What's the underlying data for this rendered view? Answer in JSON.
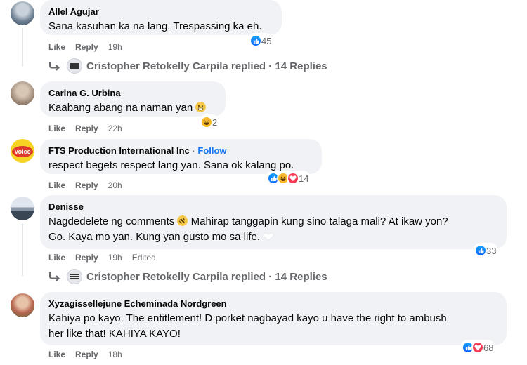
{
  "comments": [
    {
      "author": "Allel Agujar",
      "text": "Sana kasuhan ka na lang. Trespassing ka eh.",
      "actions": {
        "like": "Like",
        "reply": "Reply",
        "time": "19h"
      },
      "reactions": {
        "icons": [
          "like-icon"
        ],
        "count": "45"
      },
      "replies": {
        "name": "Cristopher Retokelly Carpila",
        "label": " replied · 14 Replies"
      }
    },
    {
      "author": "Carina G. Urbina",
      "text": "Kaabang abang na naman yan",
      "actions": {
        "like": "Like",
        "reply": "Reply",
        "time": "22h"
      },
      "reactions": {
        "icons": [
          "haha-icon"
        ],
        "count": "2"
      }
    },
    {
      "author": "FTS Production International Inc",
      "follow": "Follow",
      "text": "respect begets respect lang yan. Sana ok kalang po.",
      "actions": {
        "like": "Like",
        "reply": "Reply",
        "time": "20h"
      },
      "reactions": {
        "icons": [
          "like-icon",
          "haha-icon",
          "love-icon"
        ],
        "count": "14"
      }
    },
    {
      "author": "Denisse",
      "text_a": "Nagdedelete ng comments",
      "text_b": " Mahirap tanggapin kung sino talaga mali? At ikaw yon?",
      "text_c": "Go. Kaya mo yan. Kung yan gusto mo sa life.",
      "actions": {
        "like": "Like",
        "reply": "Reply",
        "time": "19h",
        "edited": "Edited"
      },
      "reactions": {
        "icons": [
          "like-icon"
        ],
        "count": "33"
      },
      "replies": {
        "name": "Cristopher Retokelly Carpila",
        "label": " replied · 14 Replies"
      }
    },
    {
      "author": "Xyzagissellejune Echeminada Nordgreen",
      "text_a": "Kahiya po kayo. The entitlement! D porket nagbayad kayo u have the right to ambush",
      "text_b": "her like that! KAHIYA KAYO!",
      "actions": {
        "like": "Like",
        "reply": "Reply",
        "time": "18h"
      },
      "reactions": {
        "icons": [
          "like-icon",
          "love-icon"
        ],
        "count": "68"
      }
    }
  ],
  "colors": {
    "bubble": "#f0f2f5",
    "meta": "#65676b",
    "link": "#1877f2",
    "like": "#0866ff",
    "haha": "#f7b928",
    "love": "#f33e58"
  }
}
